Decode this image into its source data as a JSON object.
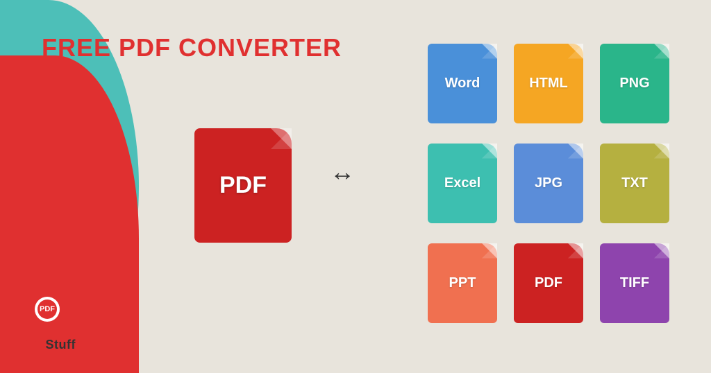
{
  "title": "FREE PDF CONVERTER",
  "pdf_label": "PDF",
  "arrow_symbol": "↔",
  "logo": {
    "text_pdf": "PDF",
    "text_stuff": "Stuff"
  },
  "formats": [
    {
      "label": "Word",
      "color": "#4a90d9"
    },
    {
      "label": "HTML",
      "color": "#f5a623"
    },
    {
      "label": "PNG",
      "color": "#2ab58a"
    },
    {
      "label": "Excel",
      "color": "#3dbfb0"
    },
    {
      "label": "JPG",
      "color": "#5b8dd9"
    },
    {
      "label": "TXT",
      "color": "#b5b040"
    },
    {
      "label": "PPT",
      "color": "#f07050"
    },
    {
      "label": "PDF",
      "color": "#cc2222"
    },
    {
      "label": "TIFF",
      "color": "#8e44ad"
    }
  ],
  "colors": {
    "teal": "#4dbfb8",
    "red": "#e03030",
    "bg": "#e8e4dc"
  }
}
